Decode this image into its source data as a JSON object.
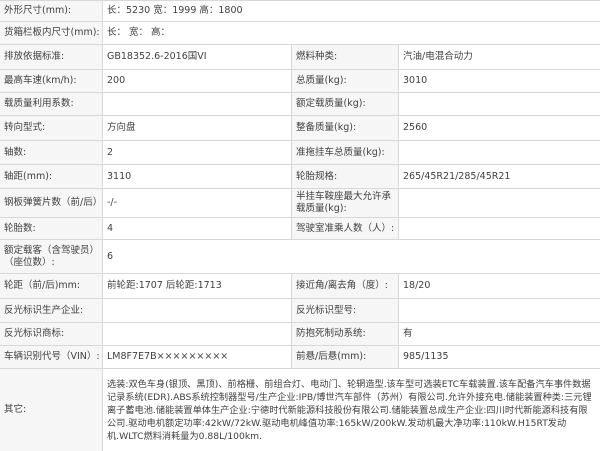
{
  "rows": [
    {
      "l1": "外形尺寸(mm):",
      "v1": "长：5230 宽：1999 高：1800",
      "span": true
    },
    {
      "l1": "货箱栏板内尺寸(mm):",
      "v1": "长：   宽：   高：",
      "span": true
    },
    {
      "l1": "排放依据标准:",
      "v1": "GB18352.6-2016国VI",
      "l2": "燃料种类:",
      "v2": "汽油/电混合动力"
    },
    {
      "l1": "最高车速(km/h):",
      "v1": "200",
      "l2": "总质量(kg):",
      "v2": "3010"
    },
    {
      "l1": "载质量利用系数:",
      "v1": "",
      "l2": "额定载质量(kg):",
      "v2": ""
    },
    {
      "l1": "转向型式:",
      "v1": "方向盘",
      "l2": "整备质量(kg):",
      "v2": "2560"
    },
    {
      "l1": "轴数:",
      "v1": "2",
      "l2": "准拖挂车总质量(kg):",
      "v2": ""
    },
    {
      "l1": "轴距(mm):",
      "v1": "3110",
      "l2": "轮胎规格:",
      "v2": "265/45R21/285/45R21"
    },
    {
      "l1": "钢板弹簧片数（前/后）:",
      "v1": "-/-",
      "l2": "半挂车鞍座最大允许承载质量(kg):",
      "v2": ""
    },
    {
      "l1": "轮胎数:",
      "v1": "4",
      "l2": "驾驶室准乘人数（人）:",
      "v2": ""
    },
    {
      "l1": "额定载客（含驾驶员）（座位数）:",
      "v1": "6",
      "span": true
    },
    {
      "l1": "轮距（前/后)mm:",
      "v1": "前轮距:1707 后轮距:1713",
      "l2": "接近角/离去角（度）:",
      "v2": "18/20"
    },
    {
      "l1": "反光标识生产企业:",
      "v1": "",
      "l2": "反光标识型号:",
      "v2": ""
    },
    {
      "l1": "反光标识商标:",
      "v1": "",
      "l2": "防抱死制动系统:",
      "v2": "有"
    },
    {
      "l1": "车辆识别代号（VIN）:",
      "v1": "LM8F7E7B×××××××××",
      "l2": "前悬/后悬(mm):",
      "v2": "985/1135"
    }
  ],
  "other": {
    "label": "其它:",
    "text": "选装:双色车身(银顶、黑顶)、前格栅、前组合灯、电动门、轮辋造型.该车型可选装ETC车载装置.该车配备汽车事件数据记录系统(EDR).ABS系统控制器型号/生产企业:IPB/博世汽车部件（苏州）有限公司.允许外接充电.储能装置种类:三元锂离子蓄电池.储能装置单体生产企业:宁德时代新能源科技股份有限公司.储能装置总成生产企业:四川时代新能源科技有限公司.驱动电机额定功率:42kW/72kW.驱动电机峰值功率:165kW/200kW.发动机最大净功率:110kW.H15RT发动机.WLTC燃料消耗量为0.88L/100km."
  }
}
